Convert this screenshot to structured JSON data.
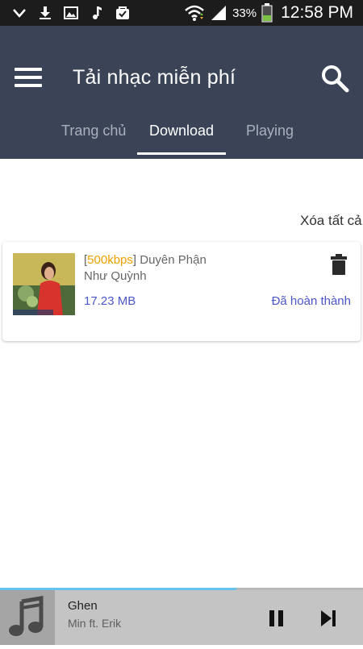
{
  "status_bar": {
    "icons_left": [
      "chevron-down-icon",
      "download-icon",
      "image-icon",
      "music-note-icon",
      "shopping-bag-icon"
    ],
    "icons_right": [
      "wifi-icon",
      "signal-icon",
      "battery-icon"
    ],
    "battery_percent": "33%",
    "time": "12:58 PM"
  },
  "app_bar": {
    "title": "Tải nhạc miễn phí",
    "background_color": "#3b4457"
  },
  "tabs": [
    {
      "label": "Trang chủ",
      "active": false
    },
    {
      "label": "Download",
      "active": true
    },
    {
      "label": "Playing",
      "active": false
    }
  ],
  "content": {
    "clear_all_label": "Xóa tất cả",
    "downloads": [
      {
        "bitrate": "500kbps",
        "title": "Duyên Phận",
        "artist": "Như Quỳnh",
        "size": "17.23 MB",
        "status": "Đã hoàn thành"
      }
    ]
  },
  "player": {
    "title": "Ghen",
    "artist": "Min ft. Erik",
    "progress": 0.65,
    "accent_color": "#66c2e8"
  }
}
